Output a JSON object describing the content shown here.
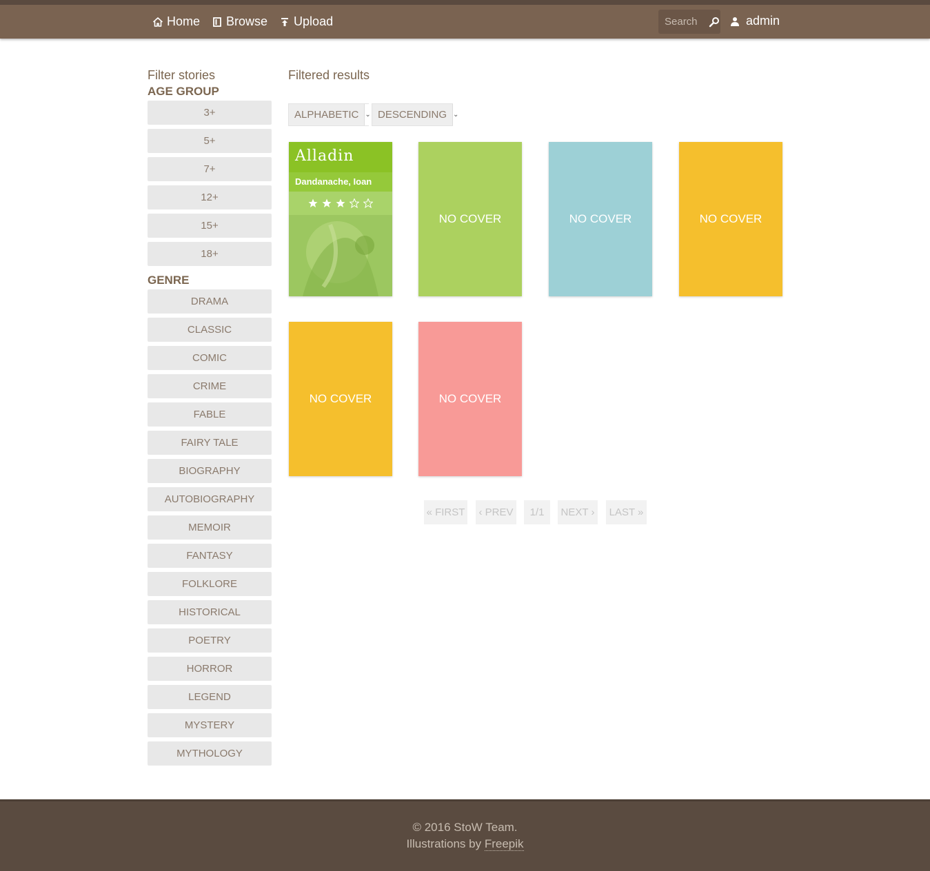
{
  "nav": {
    "home": "Home",
    "browse": "Browse",
    "upload": "Upload",
    "search_placeholder": "Search",
    "user": "admin"
  },
  "sidebar": {
    "title": "Filter stories",
    "age_group_title": "AGE GROUP",
    "age_groups": [
      "3+",
      "5+",
      "7+",
      "12+",
      "15+",
      "18+"
    ],
    "genre_title": "GENRE",
    "genres": [
      "DRAMA",
      "CLASSIC",
      "COMIC",
      "CRIME",
      "FABLE",
      "FAIRY TALE",
      "BIOGRAPHY",
      "AUTOBIOGRAPHY",
      "MEMOIR",
      "FANTASY",
      "FOLKLORE",
      "HISTORICAL",
      "POETRY",
      "HORROR",
      "LEGEND",
      "MYSTERY",
      "MYTHOLOGY"
    ]
  },
  "main": {
    "title": "Filtered results",
    "sort_by": "ALPHABETIC",
    "sort_order": "DESCENDING"
  },
  "stories": [
    {
      "title": "Alladin",
      "author": "Dandanache, Ioan",
      "rating": 3,
      "max_rating": 5,
      "has_cover": true
    },
    {
      "label": "NO COVER",
      "color": "#acd15f",
      "has_cover": false
    },
    {
      "label": "NO COVER",
      "color": "#9dd0d6",
      "has_cover": false
    },
    {
      "label": "NO COVER",
      "color": "#f5bf2d",
      "has_cover": false
    },
    {
      "label": "NO COVER",
      "color": "#f5bf2d",
      "has_cover": false
    },
    {
      "label": "NO COVER",
      "color": "#f89a97",
      "has_cover": false
    }
  ],
  "pagination": {
    "first": "« FIRST",
    "prev": "‹ PREV",
    "current": "1/1",
    "next": "NEXT ›",
    "last": "LAST »"
  },
  "footer": {
    "copyright": "© 2016 StoW Team.",
    "illustrations_prefix": "Illustrations by ",
    "illustrations_link": "Freepik"
  },
  "colors": {
    "header": "#7a6351",
    "footer": "#5a4b40",
    "text_brown": "#7b6650"
  }
}
